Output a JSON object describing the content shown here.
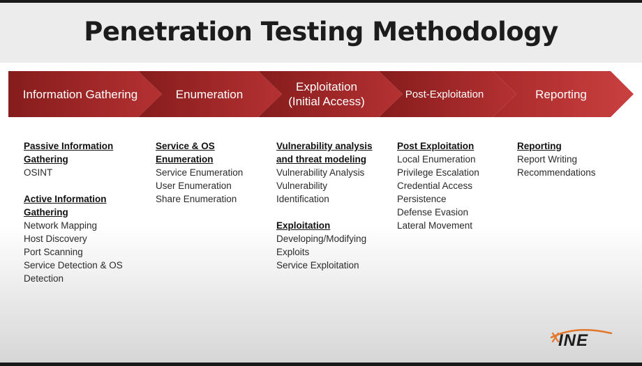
{
  "title": "Penetration Testing Methodology",
  "colors": {
    "dark_red": "#861c1c",
    "red": "#c0393a",
    "title_text": "#1c1c1c",
    "logo_orange": "#e2772b"
  },
  "phases": [
    {
      "label": "Information Gathering"
    },
    {
      "label": "Enumeration"
    },
    {
      "label": "Exploitation\n(Initial Access)"
    },
    {
      "label": "Post-Exploitation"
    },
    {
      "label": "Reporting"
    }
  ],
  "columns": [
    {
      "sections": [
        {
          "heading": "Passive Information\nGathering",
          "items": [
            "OSINT"
          ]
        },
        {
          "heading": "Active Information\nGathering",
          "items": [
            "Network Mapping",
            "Host Discovery",
            "Port Scanning",
            "Service Detection & OS\nDetection"
          ]
        }
      ]
    },
    {
      "sections": [
        {
          "heading": "Service & OS\nEnumeration",
          "items": [
            "Service Enumeration",
            "User Enumeration",
            "Share Enumeration"
          ]
        }
      ]
    },
    {
      "sections": [
        {
          "heading": "Vulnerability analysis\nand threat modeling",
          "items": [
            "Vulnerability Analysis",
            "Vulnerability\nIdentification"
          ]
        },
        {
          "heading": "Exploitation",
          "items": [
            "Developing/Modifying\nExploits",
            "Service Exploitation"
          ]
        }
      ]
    },
    {
      "sections": [
        {
          "heading": "Post Exploitation",
          "items": [
            "Local Enumeration",
            "Privilege Escalation",
            "Credential Access",
            "Persistence",
            "Defense Evasion",
            "Lateral Movement"
          ]
        }
      ]
    },
    {
      "sections": [
        {
          "heading": "Reporting",
          "items": [
            "Report Writing",
            "Recommendations"
          ]
        }
      ]
    }
  ],
  "logo": {
    "text": "INE",
    "icon": "ine-logo"
  }
}
